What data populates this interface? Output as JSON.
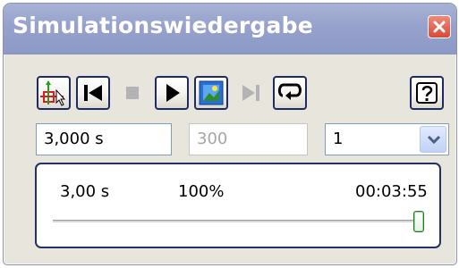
{
  "window": {
    "title": "Simulationswiedergabe"
  },
  "toolbar": {
    "buttons": [
      {
        "name": "construct-icon",
        "enabled": true
      },
      {
        "name": "skip-to-start-icon",
        "enabled": true
      },
      {
        "name": "stop-icon",
        "enabled": false
      },
      {
        "name": "play-icon",
        "enabled": true
      },
      {
        "name": "screen-capture-icon",
        "enabled": true
      },
      {
        "name": "skip-to-end-icon",
        "enabled": false
      },
      {
        "name": "loop-icon",
        "enabled": true
      },
      {
        "name": "help-icon",
        "enabled": true
      }
    ]
  },
  "fields": {
    "end_time": "3,000 s",
    "steps": "300",
    "speed": "1"
  },
  "status": {
    "current_time": "3,00 s",
    "percent": "100%",
    "elapsed": "00:03:55",
    "progress_fraction": 1.0
  },
  "colors": {
    "titlebar": "#96a2cc",
    "frame": "#24306a",
    "dialog_bg": "#e8e5dc",
    "close_red": "#d84a36",
    "thumb_green": "#1f7a1f"
  }
}
